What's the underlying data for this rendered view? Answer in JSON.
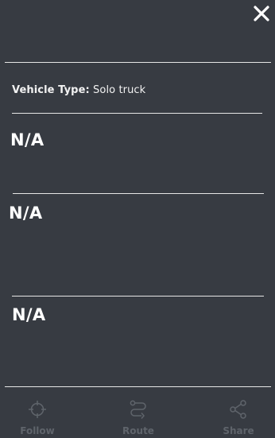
{
  "panel": {
    "vehicle_type_label": "Vehicle Type:",
    "vehicle_type_value": "Solo truck",
    "sections": [
      {
        "value": "N/A"
      },
      {
        "value": "N/A"
      },
      {
        "value": "N/A"
      }
    ]
  },
  "bottom_nav": {
    "follow_label": "Follow",
    "route_label": "Route",
    "share_label": "Share",
    "follow_icon": "crosshair-icon",
    "route_icon": "route-icon",
    "share_icon": "share-icon"
  },
  "colors": {
    "background": "#373b42",
    "text": "#ffffff",
    "divider": "#e6e6e6",
    "nav_inactive": "#5f646b"
  }
}
